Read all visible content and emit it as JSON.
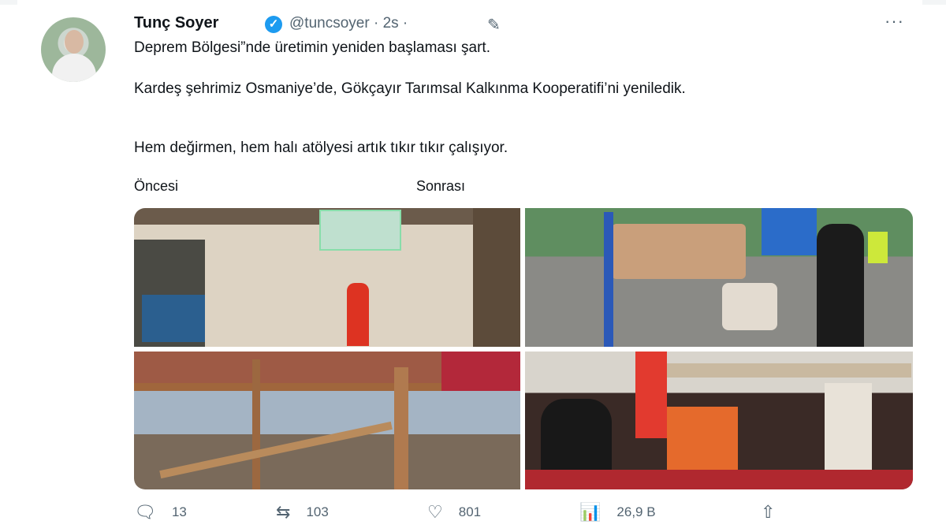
{
  "tweet": {
    "author_name": "Tunç Soyer",
    "handle": "@tuncsoyer",
    "time": "2s",
    "separator": "·",
    "lines": [
      "Deprem Bölgesi”nde üretimin yeniden başlaması şart.",
      "Kardeş şehrimiz Osmaniye’de, Gökçayır Tarımsal Kalkınma Kooperatifi’ni yeniledik.",
      "Hem değirmen, hem halı atölyesi artık tıkır tıkır çalışıyor."
    ],
    "captions": {
      "before": "Öncesi",
      "after": "Sonrası"
    },
    "verified_glyph": "✓",
    "more_glyph": "···",
    "edit_icon_glyph": "✎"
  },
  "actions": [
    {
      "name": "reply",
      "icon": "reply-icon",
      "glyph": "🗨",
      "count": "13"
    },
    {
      "name": "retweet",
      "icon": "retweet-icon",
      "glyph": "⇆",
      "count": "103"
    },
    {
      "name": "like",
      "icon": "heart-icon",
      "glyph": "♡",
      "count": "801"
    },
    {
      "name": "views",
      "icon": "views-icon",
      "glyph": "📊",
      "count": "26,9 B"
    },
    {
      "name": "share",
      "icon": "share-icon",
      "glyph": "⇧",
      "count": ""
    }
  ],
  "colors": {
    "verified": "#1d9bf0",
    "muted": "#536471",
    "text": "#0f1419"
  }
}
